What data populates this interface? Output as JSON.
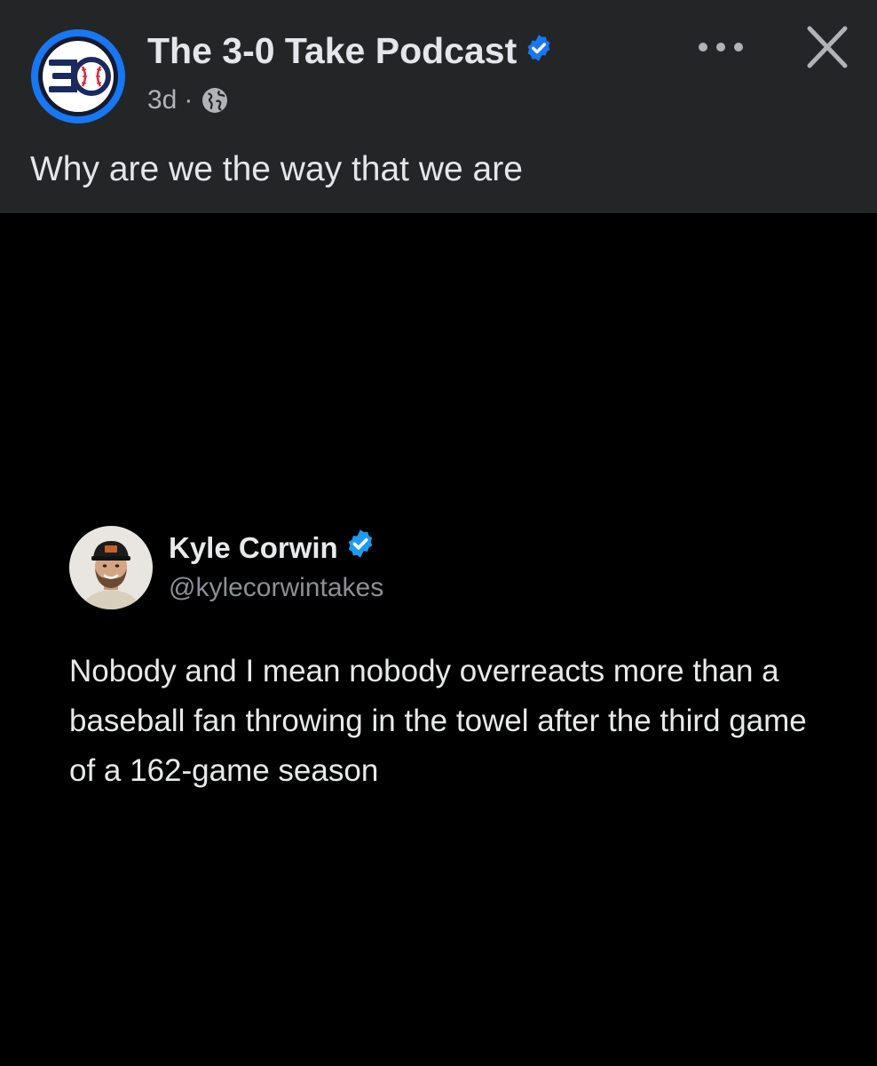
{
  "post": {
    "author": "The 3-0 Take Podcast",
    "verified_icon": "verified-badge-icon",
    "timestamp": "3d",
    "separator": "·",
    "audience_icon": "globe-icon",
    "more_icon": "more-options-icon",
    "close_icon": "close-icon",
    "caption": "Why are we the way that we are",
    "logo_icon": "podcast-logo-icon"
  },
  "tweet": {
    "name": "Kyle Corwin",
    "handle": "@kylecorwintakes",
    "text": "Nobody and I mean nobody overreacts more than a baseball fan throwing in the towel after the third game of a 162-game season",
    "avatar_icon": "profile-photo"
  },
  "colors": {
    "header_bg": "#242526",
    "content_bg": "#000000",
    "primary_text": "#e4e6eb",
    "secondary_text": "#b0b3b8",
    "verified_blue": "#1d9bf0",
    "logo_blue": "#1877f2",
    "logo_navy": "#1a2a5e",
    "logo_red": "#d62b3a"
  }
}
